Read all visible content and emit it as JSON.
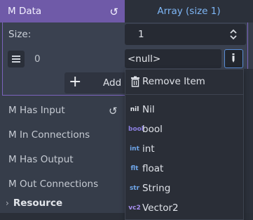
{
  "property": {
    "name": "M Data",
    "array_label": "Array (size 1)"
  },
  "array": {
    "size_label": "Size:",
    "size_value": "1",
    "item_index": "0",
    "item_value": "<null>",
    "add_label": "Add"
  },
  "properties": [
    {
      "name": "M Has Input"
    },
    {
      "name": "M In Connections"
    },
    {
      "name": "M Has Output"
    },
    {
      "name": "M Out Connections"
    }
  ],
  "section": {
    "name": "Resource"
  },
  "menu": {
    "remove_label": "Remove Item",
    "items": [
      {
        "badge": "nil",
        "label": "Nil"
      },
      {
        "badge": "bool",
        "label": "bool"
      },
      {
        "badge": "int",
        "label": "int"
      },
      {
        "badge": "flt",
        "label": "float"
      },
      {
        "badge": "str",
        "label": "String"
      },
      {
        "badge": "vc2",
        "label": "Vector2"
      }
    ]
  },
  "colors": {
    "accent_purple": "#6f5aa8",
    "link_blue": "#7eb6f5",
    "badge_blue": "#6fa6ea",
    "badge_purple": "#8b7fe0"
  }
}
